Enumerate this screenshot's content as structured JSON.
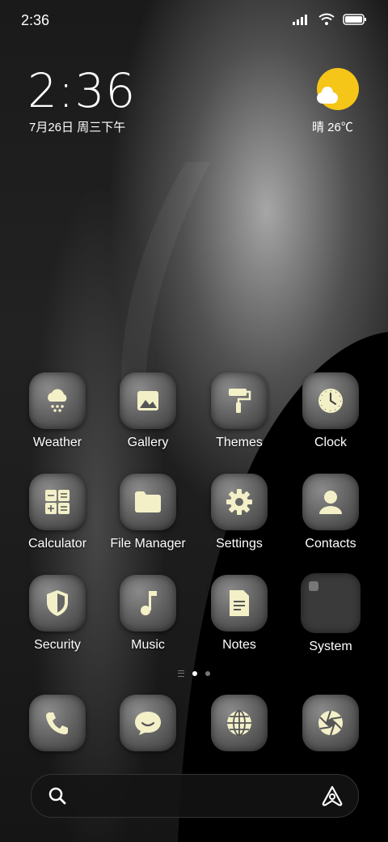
{
  "status_bar": {
    "time": "2:36"
  },
  "widget": {
    "time": "2:36",
    "date": "7月26日 周三下午",
    "weather": "晴 26℃",
    "sun_color": "#f5c518"
  },
  "apps": [
    {
      "label": "Weather",
      "icon": "weather-snow-icon"
    },
    {
      "label": "Gallery",
      "icon": "image-icon"
    },
    {
      "label": "Themes",
      "icon": "paint-roller-icon"
    },
    {
      "label": "Clock",
      "icon": "clock-icon"
    },
    {
      "label": "Calculator",
      "icon": "calculator-icon"
    },
    {
      "label": "File Manager",
      "icon": "folder-icon"
    },
    {
      "label": "Settings",
      "icon": "gear-icon"
    },
    {
      "label": "Contacts",
      "icon": "person-icon"
    },
    {
      "label": "Security",
      "icon": "shield-icon"
    },
    {
      "label": "Music",
      "icon": "music-note-icon"
    },
    {
      "label": "Notes",
      "icon": "document-icon"
    },
    {
      "label": "System",
      "icon": "folder-icon"
    }
  ],
  "dock": [
    {
      "icon": "phone-icon"
    },
    {
      "icon": "message-icon"
    },
    {
      "icon": "globe-icon"
    },
    {
      "icon": "camera-aperture-icon"
    }
  ],
  "page_indicator": {
    "pages": 2,
    "current": 1
  },
  "icon_color": "#f3f0c8"
}
